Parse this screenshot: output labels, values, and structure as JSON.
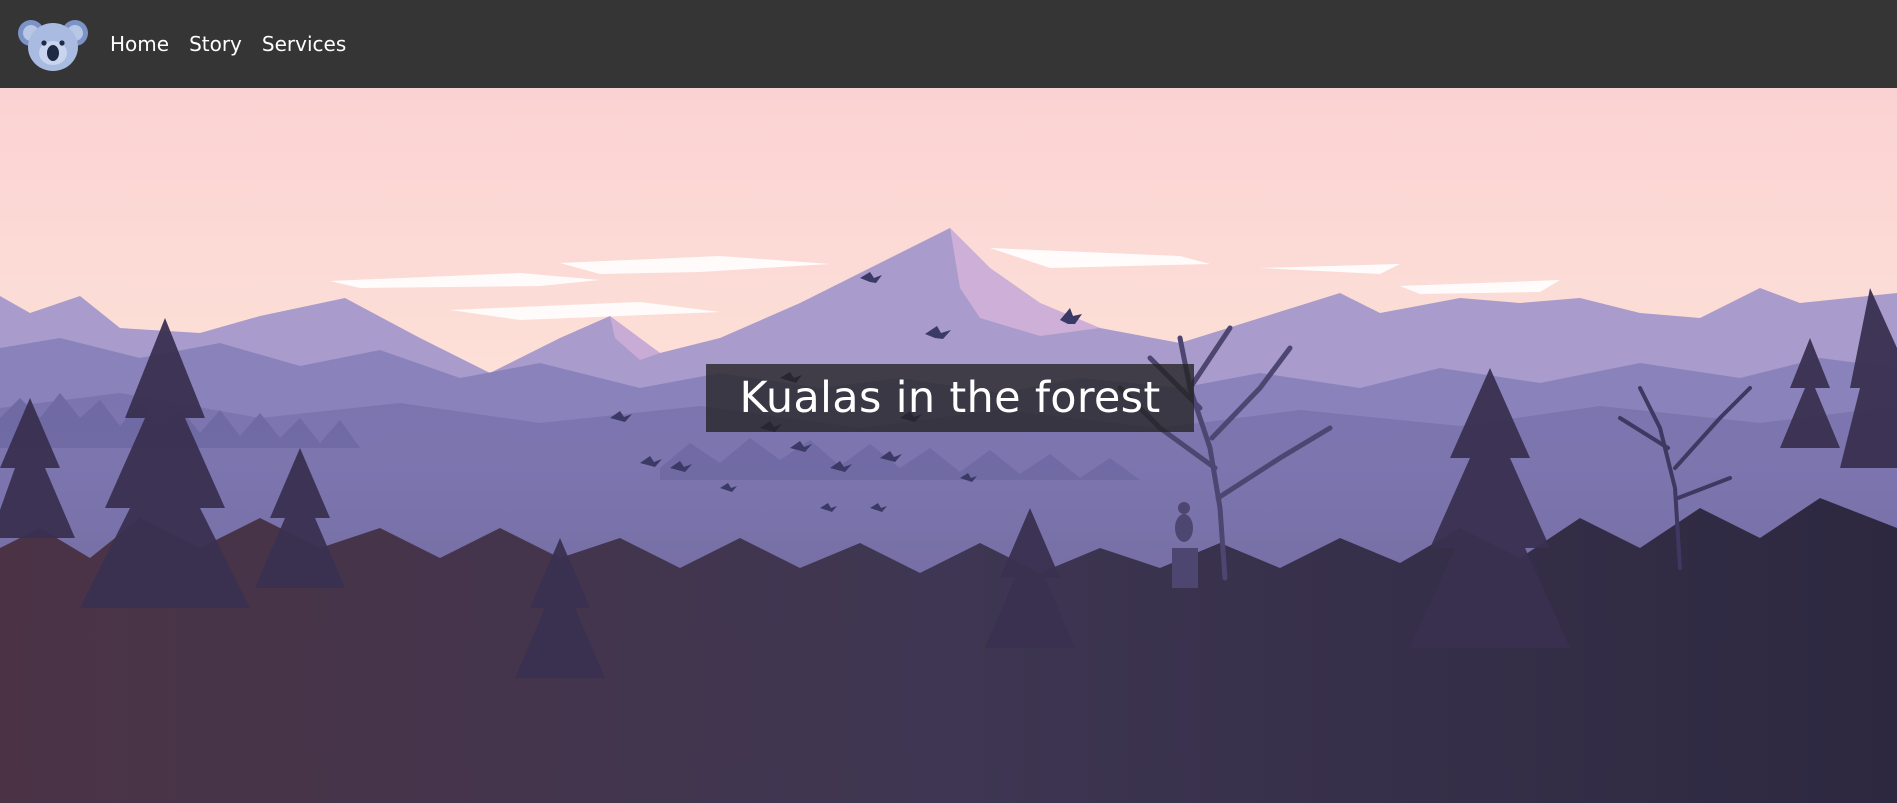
{
  "site": {
    "logo_icon": "koala-logo-icon"
  },
  "nav": {
    "items": [
      {
        "label": "Home"
      },
      {
        "label": "Story"
      },
      {
        "label": "Services"
      }
    ]
  },
  "hero": {
    "title": "Kualas in the forest",
    "image": "forest-mountain-landscape-illustration"
  },
  "colors": {
    "navbar_bg": "#353535",
    "sky_top": "#fbd3d4",
    "sky_bottom": "#fde4d8",
    "mountain_far": "#9b8fc4",
    "forest_dark": "#3a3050",
    "title_box_bg": "#232323"
  }
}
